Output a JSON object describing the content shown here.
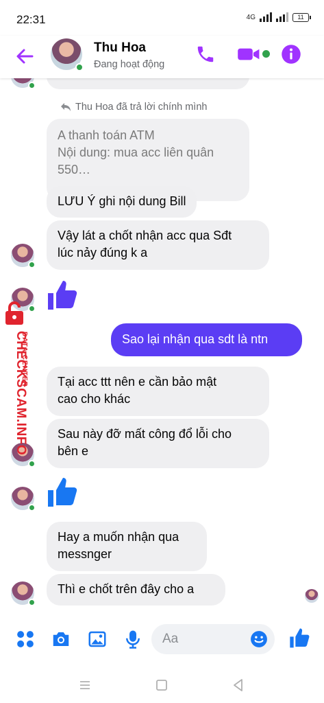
{
  "status_bar": {
    "time": "22:31",
    "network": "4G",
    "battery": "11"
  },
  "header": {
    "name": "Thu Hoa",
    "status": "Đang hoạt động"
  },
  "colors": {
    "accent": "#a033ff",
    "sent_bubble": "#5b3df4",
    "online": "#31a24c",
    "composer_icons": "#1877f2",
    "watermark": "#e0242e"
  },
  "conversation": {
    "reply_note": "Thu Hoa đã trả lời chính mình",
    "quoted_message": [
      "A thanh toán ATM",
      "Nội dung: mua acc liên quân",
      "550…"
    ],
    "messages": [
      {
        "sender": "them",
        "text": "LƯU Ý ghi nội dung Bill"
      },
      {
        "sender": "them",
        "lines": [
          "Vậy lát a chốt nhận acc qua Sđt",
          "lúc nảy đúng k a"
        ]
      },
      {
        "sender": "them",
        "type": "like",
        "icon": "thumbs-up-icon"
      },
      {
        "sender": "me",
        "text": "Sao lại nhận qua sdt là ntn"
      },
      {
        "sender": "them",
        "lines": [
          "Tại acc ttt nên e cần bảo mật",
          "cao cho khác"
        ]
      },
      {
        "sender": "them",
        "lines": [
          "Sau này đỡ mất công đổ lỗi cho",
          "bên e"
        ]
      },
      {
        "sender": "them",
        "type": "like",
        "icon": "thumbs-up-icon"
      },
      {
        "sender": "them",
        "lines": [
          "Hay a muốn nhận qua",
          "messnger"
        ]
      },
      {
        "sender": "them",
        "text": "Thì e chốt trên đây cho a"
      }
    ]
  },
  "watermark": {
    "main": "CHECKSCAM.INFO",
    "sub": "DATA CENTER"
  },
  "composer": {
    "placeholder": "Aa"
  },
  "icons": [
    "back-arrow-icon",
    "phone-icon",
    "video-icon",
    "info-icon",
    "apps-icon",
    "camera-icon",
    "image-icon",
    "mic-icon",
    "emoji-icon",
    "thumbs-up-icon"
  ]
}
